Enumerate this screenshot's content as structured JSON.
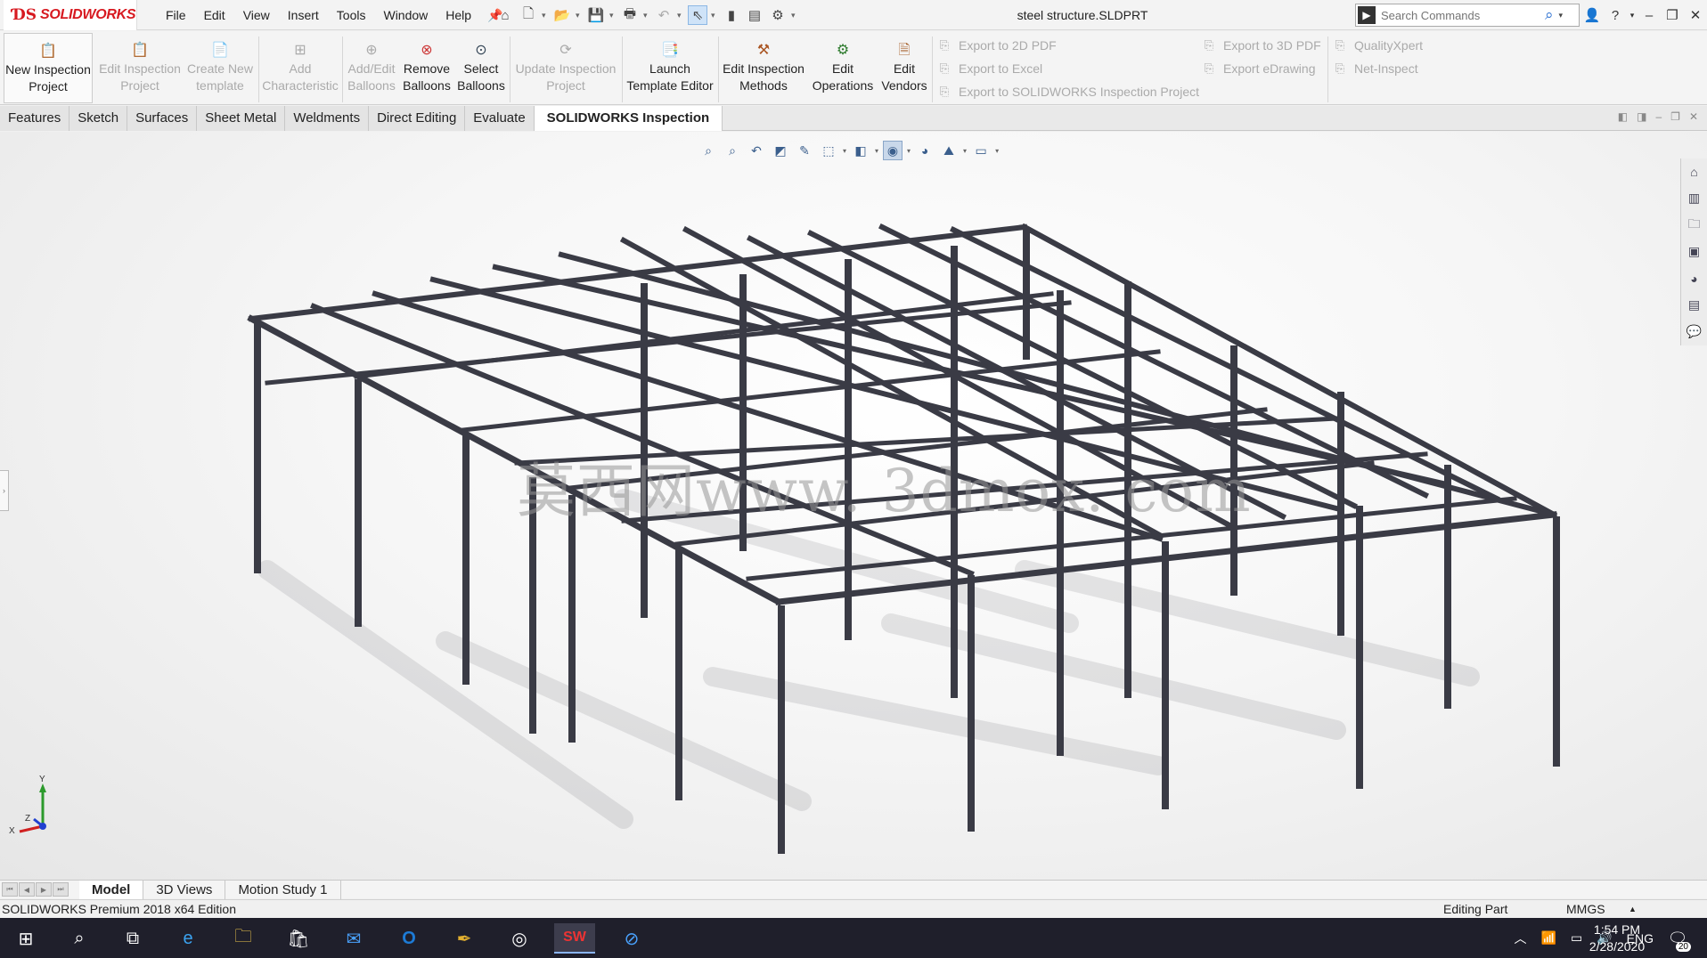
{
  "app": {
    "brand": "SOLIDWORKS",
    "document_title": "steel structure.SLDPRT"
  },
  "menu": [
    "File",
    "Edit",
    "View",
    "Insert",
    "Tools",
    "Window",
    "Help"
  ],
  "search": {
    "placeholder": "Search Commands"
  },
  "ribbon": {
    "buttons": [
      {
        "label": "New Inspection Project",
        "l1": "New Inspection",
        "l2": "Project",
        "enabled": true
      },
      {
        "label": "Edit Inspection Project",
        "l1": "Edit Inspection",
        "l2": "Project",
        "enabled": false
      },
      {
        "label": "Create New template",
        "l1": "Create New",
        "l2": "template",
        "enabled": false
      },
      {
        "label": "Add Characteristic",
        "l1": "Add",
        "l2": "Characteristic",
        "enabled": false
      },
      {
        "label": "Add/Edit Balloons",
        "l1": "Add/Edit",
        "l2": "Balloons",
        "enabled": false
      },
      {
        "label": "Remove Balloons",
        "l1": "Remove",
        "l2": "Balloons",
        "enabled": true
      },
      {
        "label": "Select Balloons",
        "l1": "Select",
        "l2": "Balloons",
        "enabled": true
      },
      {
        "label": "Update Inspection Project",
        "l1": "Update Inspection",
        "l2": "Project",
        "enabled": false
      },
      {
        "label": "Launch Template Editor",
        "l1": "Launch",
        "l2": "Template Editor",
        "enabled": true
      },
      {
        "label": "Edit Inspection Methods",
        "l1": "Edit Inspection",
        "l2": "Methods",
        "enabled": true
      },
      {
        "label": "Edit Operations",
        "l1": "Edit",
        "l2": "Operations",
        "enabled": true
      },
      {
        "label": "Edit Vendors",
        "l1": "Edit",
        "l2": "Vendors",
        "enabled": true
      }
    ],
    "exports": [
      "Export to 2D PDF",
      "Export to Excel",
      "Export to SOLIDWORKS Inspection Project",
      "Export to 3D PDF",
      "Export eDrawing",
      "QualityXpert",
      "Net-Inspect"
    ]
  },
  "tabs": [
    "Features",
    "Sketch",
    "Surfaces",
    "Sheet Metal",
    "Weldments",
    "Direct Editing",
    "Evaluate",
    "SOLIDWORKS Inspection"
  ],
  "active_tab": "SOLIDWORKS Inspection",
  "watermark": "莫西网www. 3dmox. com",
  "triad": {
    "x": "X",
    "y": "Y",
    "z": "Z"
  },
  "bottom_tabs": [
    "Model",
    "3D Views",
    "Motion Study 1"
  ],
  "status": {
    "edition": "SOLIDWORKS Premium 2018 x64 Edition",
    "mode": "Editing Part",
    "units": "MMGS"
  },
  "taskbar": {
    "language": "ENG",
    "time": "1:54 PM",
    "date": "2/28/2020",
    "notifications": "20"
  }
}
